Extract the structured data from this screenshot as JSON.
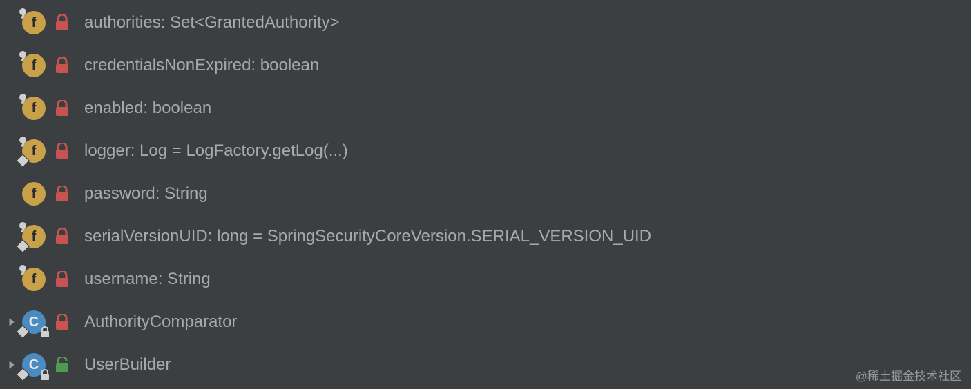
{
  "members": [
    {
      "name": "authorities",
      "type": "Set<GrantedAuthority>",
      "value": null,
      "icon": "field",
      "access": "private",
      "pin": true,
      "static": false,
      "class_lock": false,
      "expandable": false
    },
    {
      "name": "credentialsNonExpired",
      "type": "boolean",
      "value": null,
      "icon": "field",
      "access": "private",
      "pin": true,
      "static": false,
      "class_lock": false,
      "expandable": false
    },
    {
      "name": "enabled",
      "type": "boolean",
      "value": null,
      "icon": "field",
      "access": "private",
      "pin": true,
      "static": false,
      "class_lock": false,
      "expandable": false
    },
    {
      "name": "logger",
      "type": "Log",
      "value": "LogFactory.getLog(...)",
      "icon": "field",
      "access": "private",
      "pin": true,
      "static": true,
      "class_lock": false,
      "expandable": false
    },
    {
      "name": "password",
      "type": "String",
      "value": null,
      "icon": "field",
      "access": "private",
      "pin": false,
      "static": false,
      "class_lock": false,
      "expandable": false
    },
    {
      "name": "serialVersionUID",
      "type": "long",
      "value": "SpringSecurityCoreVersion.SERIAL_VERSION_UID",
      "icon": "field",
      "access": "private",
      "pin": true,
      "static": true,
      "class_lock": false,
      "expandable": false
    },
    {
      "name": "username",
      "type": "String",
      "value": null,
      "icon": "field",
      "access": "private",
      "pin": true,
      "static": false,
      "class_lock": false,
      "expandable": false
    },
    {
      "name": "AuthorityComparator",
      "type": null,
      "value": null,
      "icon": "class",
      "access": "private",
      "pin": false,
      "static": true,
      "class_lock": true,
      "expandable": true
    },
    {
      "name": "UserBuilder",
      "type": null,
      "value": null,
      "icon": "class",
      "access": "public",
      "pin": false,
      "static": true,
      "class_lock": true,
      "expandable": true
    }
  ],
  "watermark": "@稀土掘金技术社区"
}
